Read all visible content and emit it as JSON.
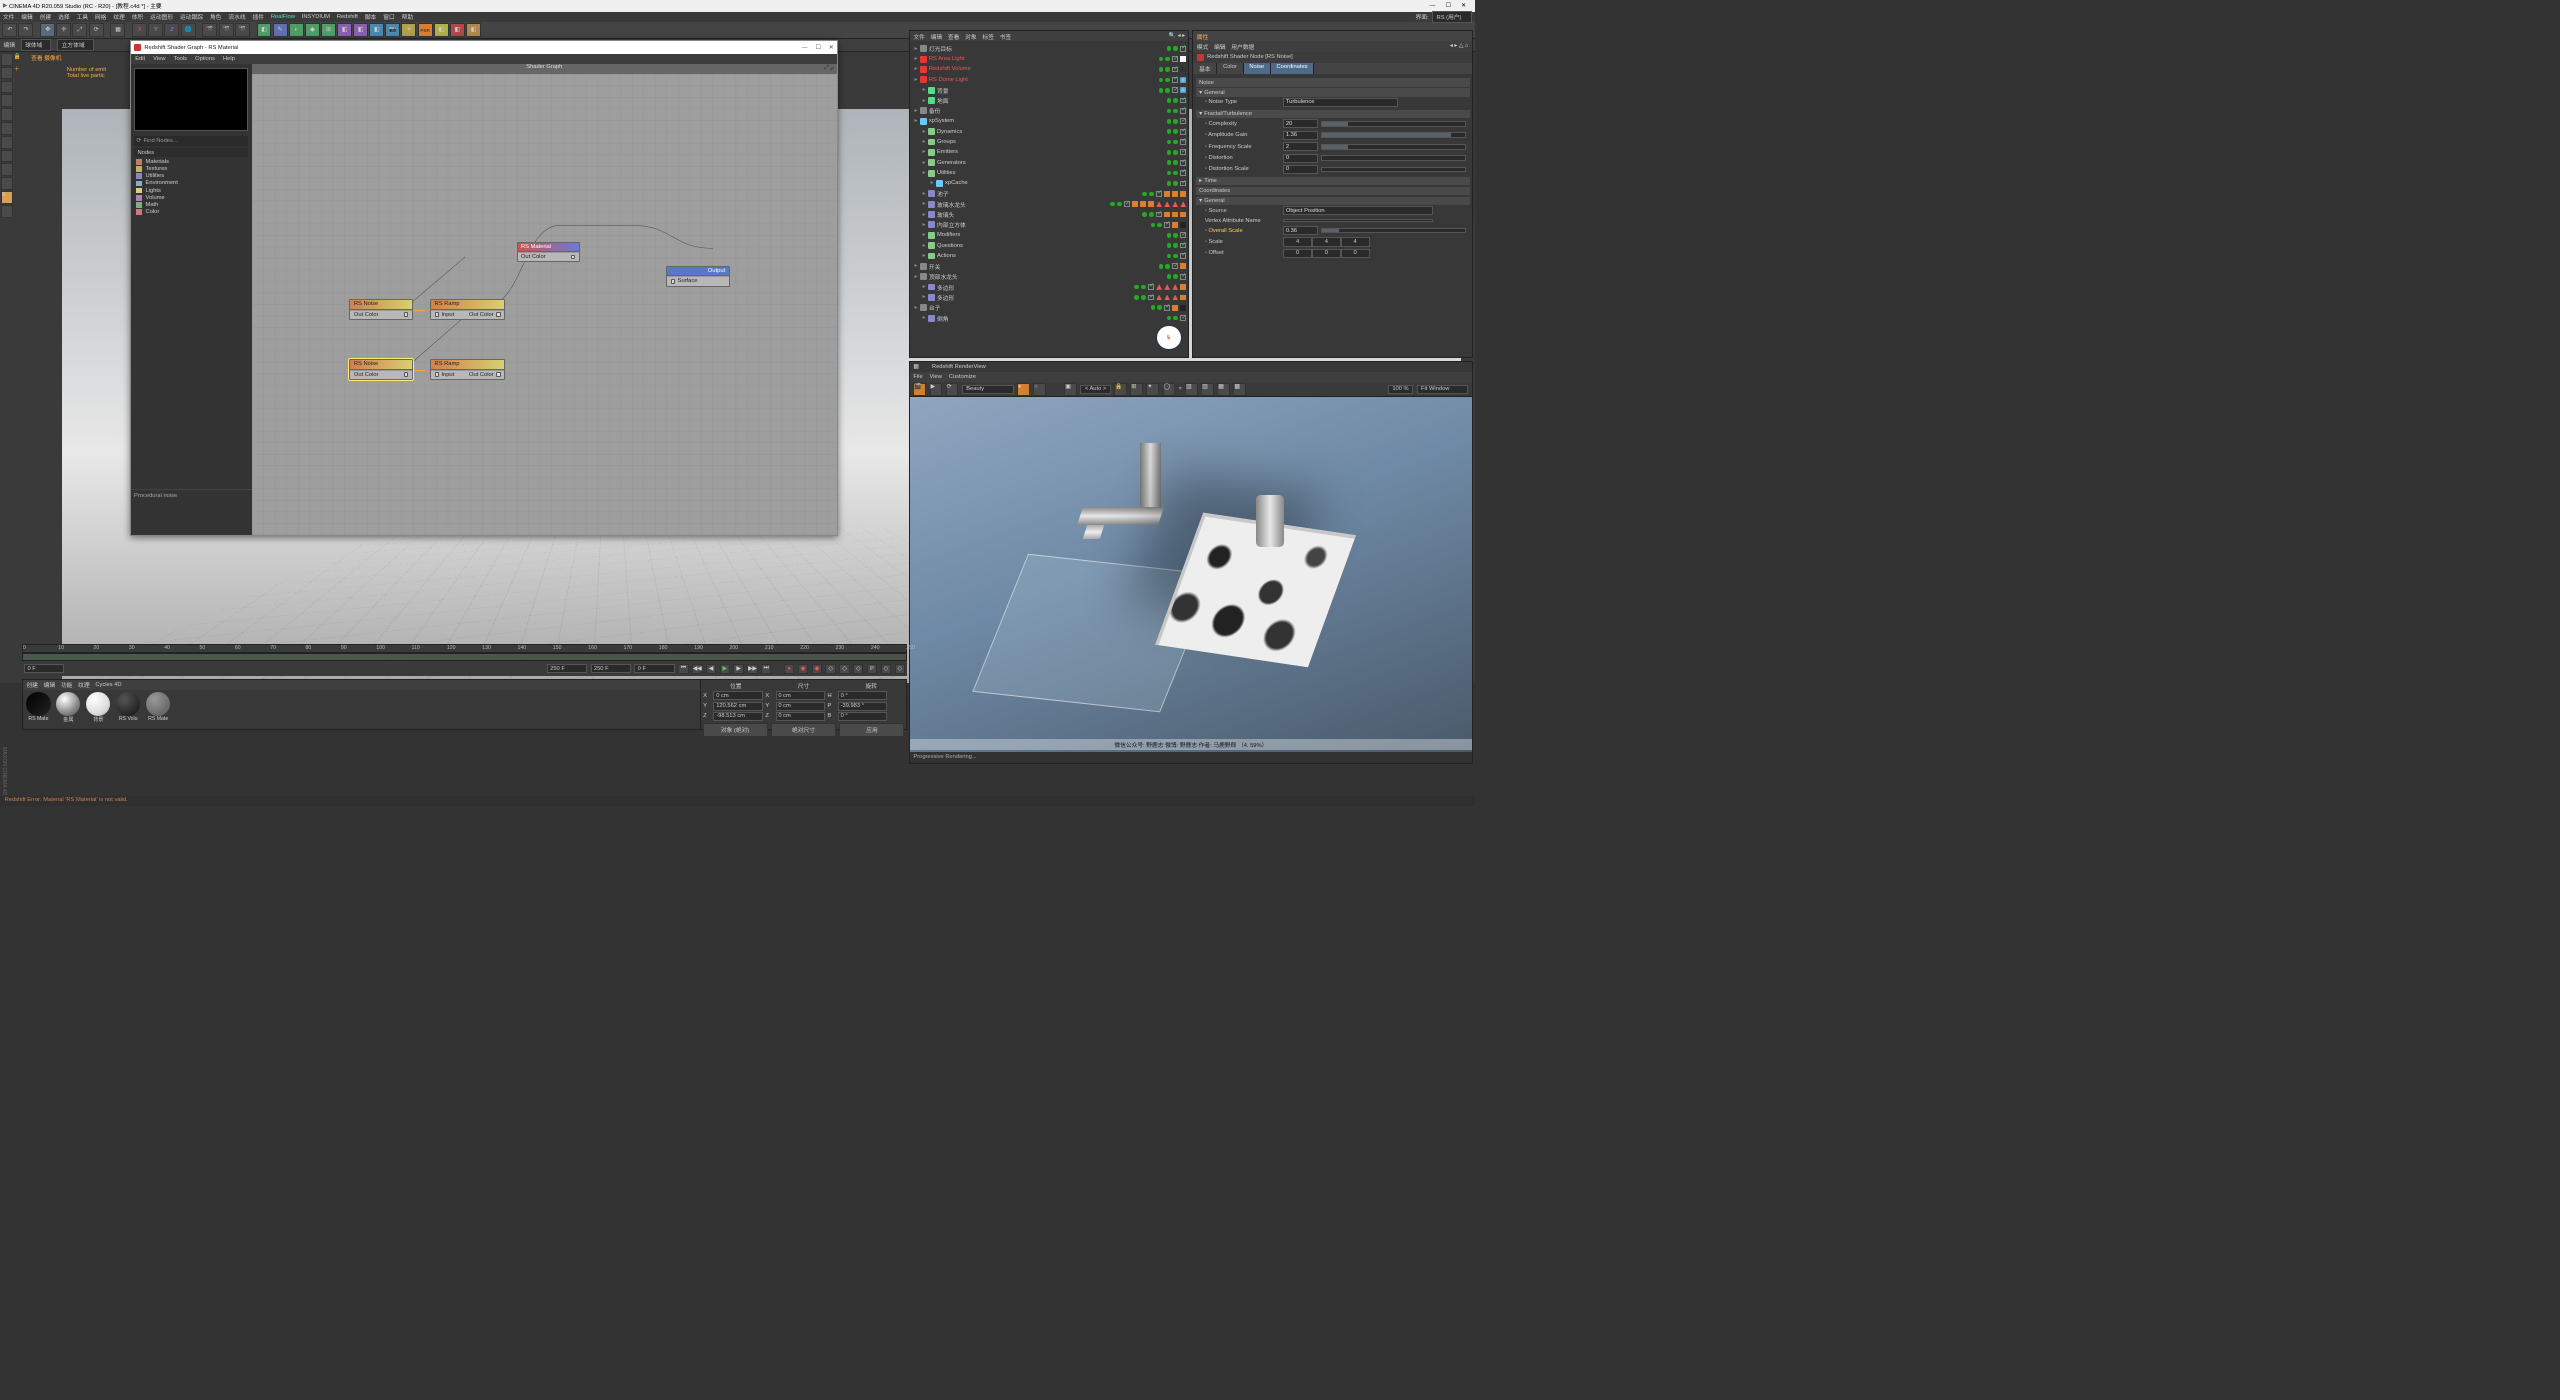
{
  "title": "CINEMA 4D R20.059 Studio (RC - R20) - [教程.c4d *] - 主要",
  "menus": [
    "文件",
    "编辑",
    "创建",
    "选择",
    "工具",
    "网格",
    "纹理",
    "体积",
    "运动图形",
    "运动跟踪",
    "角色",
    "流水线",
    "插件",
    "RealFlow",
    "INSYDIUM",
    "Redshift",
    "脚本",
    "窗口",
    "帮助"
  ],
  "layout_label": "界面:",
  "layout_value": "RS (用户)",
  "tool2": {
    "a": "编辑",
    "b": "球体域",
    "c": "立方体域"
  },
  "vpinfo": {
    "a": "查看  摄像机",
    "b": "Number of emit",
    "c": "Total live partic"
  },
  "sg": {
    "title": "Redshift Shader Graph - RS Material",
    "menus": [
      "Edit",
      "View",
      "Tools",
      "Options",
      "Help"
    ],
    "find": "Find Nodes...",
    "nodes_h": "Nodes",
    "cats": [
      {
        "name": "Materials",
        "c": "#c08060"
      },
      {
        "name": "Textures",
        "c": "#c0b060"
      },
      {
        "name": "Utilities",
        "c": "#8888c0"
      },
      {
        "name": "Environment",
        "c": "#88b0c8"
      },
      {
        "name": "Lights",
        "c": "#d8d080"
      },
      {
        "name": "Volume",
        "c": "#b080b0"
      },
      {
        "name": "Math",
        "c": "#80b080"
      },
      {
        "name": "Color",
        "c": "#d07878"
      }
    ],
    "canvas_title": "Shader Graph",
    "info": "Procedural noise",
    "n": {
      "noise1": {
        "t": "RS Noise",
        "p": "Out Color"
      },
      "noise2": {
        "t": "RS Noise",
        "p": "Out Color"
      },
      "ramp1": {
        "t": "RS Ramp",
        "pin": "Input",
        "pout": "Out Color"
      },
      "ramp2": {
        "t": "RS Ramp",
        "pin": "Input",
        "pout": "Out Color"
      },
      "mat": {
        "t": "RS Material",
        "p": "Out Color"
      },
      "out": {
        "t": "Output",
        "p": "Surface"
      }
    }
  },
  "objmgr": {
    "menus": [
      "文件",
      "编辑",
      "查看",
      "对象",
      "标签",
      "书签"
    ],
    "rows": [
      {
        "d": 0,
        "nm": "灯光目标",
        "ic": "#888",
        "rs": false
      },
      {
        "d": 0,
        "nm": "RS Area Light",
        "ic": "#e33",
        "rs": true,
        "tags": [
          "cir"
        ]
      },
      {
        "d": 0,
        "nm": "Redshift Volume",
        "ic": "#e33",
        "rs": true,
        "tags": [
          "sq"
        ]
      },
      {
        "d": 0,
        "nm": "RS Dome Light",
        "ic": "#e33",
        "rs": true,
        "tags": [
          "env"
        ]
      },
      {
        "d": 1,
        "nm": "背景",
        "ic": "#5d8",
        "tags": [
          "env2"
        ]
      },
      {
        "d": 1,
        "nm": "地面",
        "ic": "#5d8"
      },
      {
        "d": 0,
        "nm": "备份",
        "ic": "#888"
      },
      {
        "d": 0,
        "nm": "xpSystem",
        "ic": "#6cf"
      },
      {
        "d": 1,
        "nm": "Dynamics",
        "ic": "#8c8"
      },
      {
        "d": 1,
        "nm": "Groups",
        "ic": "#8c8"
      },
      {
        "d": 1,
        "nm": "Emitters",
        "ic": "#8c8"
      },
      {
        "d": 1,
        "nm": "Generators",
        "ic": "#8c8"
      },
      {
        "d": 1,
        "nm": "Utilities",
        "ic": "#8c8"
      },
      {
        "d": 2,
        "nm": "xpCache",
        "ic": "#6cf"
      },
      {
        "d": 1,
        "nm": "池子",
        "ic": "#88c",
        "tags": [
          "m",
          "m",
          "m"
        ]
      },
      {
        "d": 1,
        "nm": "玻璃水龙头",
        "ic": "#88c",
        "tags": [
          "m",
          "m",
          "m",
          "t",
          "t",
          "t",
          "t"
        ]
      },
      {
        "d": 1,
        "nm": "玻璃头",
        "ic": "#88c",
        "tags": [
          "m",
          "m",
          "m"
        ]
      },
      {
        "d": 1,
        "nm": "内部立方体",
        "ic": "#88c",
        "tags": [
          "m",
          "sq2"
        ]
      },
      {
        "d": 1,
        "nm": "Modifiers",
        "ic": "#8c8"
      },
      {
        "d": 1,
        "nm": "Questions",
        "ic": "#8c8"
      },
      {
        "d": 1,
        "nm": "Actions",
        "ic": "#8c8"
      },
      {
        "d": 0,
        "nm": "开关",
        "ic": "#888",
        "tags": [
          "m"
        ]
      },
      {
        "d": 0,
        "nm": "顶部水龙头",
        "ic": "#888"
      },
      {
        "d": 1,
        "nm": "多边形",
        "ic": "#88c",
        "tags": [
          "t",
          "t",
          "t",
          "m"
        ]
      },
      {
        "d": 1,
        "nm": "多边形",
        "ic": "#88c",
        "tags": [
          "t",
          "t",
          "t",
          "m"
        ]
      },
      {
        "d": 0,
        "nm": "台子",
        "ic": "#888",
        "tags": [
          "m",
          "sq2"
        ]
      },
      {
        "d": 1,
        "nm": "倒角",
        "ic": "#88c"
      }
    ]
  },
  "attr": {
    "menus": [
      "模式",
      "编辑",
      "用户数据"
    ],
    "title": "Redshift Shader Node [RS Noise]",
    "tabs": [
      "基本",
      "Color",
      "Noise",
      "Coordinates"
    ],
    "active": [
      2,
      3
    ],
    "noise_h": "Noise",
    "gen_h": "General",
    "noisetype_l": "Noise Type",
    "noisetype_v": "Turbulence",
    "ft_h": "Fractal/Turbulence",
    "fields": [
      {
        "l": "Complexity",
        "v": "20",
        "f": 0.18
      },
      {
        "l": "Amplitude Gain",
        "v": "1.36",
        "f": 0.9
      },
      {
        "l": "Frequency Scale",
        "v": "2",
        "f": 0.18
      },
      {
        "l": "Distortion",
        "v": "0",
        "f": 0
      },
      {
        "l": "Distortion Scale",
        "v": "0",
        "f": 0
      }
    ],
    "time_h": "Time",
    "coord_h": "Coordinates",
    "source_l": "Source",
    "source_v": "Object Position",
    "van_l": "Vertex Attribute Name",
    "overall_l": "Overall Scale",
    "overall_v": "0.36",
    "overall_f": 0.12,
    "scale_l": "Scale",
    "scale_v": [
      "4",
      "4",
      "4"
    ],
    "offset_l": "Offset",
    "offset_v": [
      "0",
      "0",
      "0"
    ],
    "p_h": "属性"
  },
  "rv": {
    "h": "Redshift RenderView",
    "menus": [
      "File",
      "View",
      "Customize"
    ],
    "aov": "Beauty",
    "auto": "< Auto >",
    "zoom": "100 %",
    "fit": "Fit Window",
    "cap": "微信公众号: 野鹿志    微博: 野鹿志    作者: 马鹿野郎  （4. 59%）",
    "status": "Progressive Rendering..."
  },
  "tl": {
    "ticks": [
      "0",
      "10",
      "20",
      "30",
      "40",
      "50",
      "60",
      "70",
      "80",
      "90",
      "100",
      "110",
      "120",
      "130",
      "140",
      "150",
      "160",
      "170",
      "180",
      "190",
      "200",
      "210",
      "220",
      "230",
      "240",
      "250"
    ],
    "f0": "0 F",
    "f1": "250 F",
    "f2": "250 F",
    "f3": "0 F"
  },
  "mat": {
    "tabs": [
      "创建",
      "编辑",
      "功能",
      "纹理",
      "Cycles 4D"
    ],
    "items": [
      {
        "nm": "RS Mate",
        "bg": "linear-gradient(135deg,#000,#222)"
      },
      {
        "nm": "金属",
        "bg": "radial-gradient(circle at 35% 30%,#fff,#888 60%,#444)"
      },
      {
        "nm": "背景",
        "bg": "radial-gradient(circle at 35% 30%,#fff,#ddd 60%,#aaa)"
      },
      {
        "nm": "RS Volu",
        "bg": "radial-gradient(circle at 35% 30%,#555,#111)"
      },
      {
        "nm": "RS Mate",
        "bg": "radial-gradient(circle at 35% 30%,#999,#555)"
      }
    ]
  },
  "coord": {
    "h": [
      "位置",
      "尺寸",
      "旋转"
    ],
    "rows": [
      {
        "a": "X",
        "p": "0 cm",
        "s": "0 cm",
        "r": "0 °",
        "ax": "X",
        "sx": "X",
        "rx": "H"
      },
      {
        "a": "Y",
        "p": "120.562 cm",
        "s": "0 cm",
        "r": "-39.983 °",
        "ax": "Y",
        "sx": "Y",
        "rx": "P"
      },
      {
        "a": "Z",
        "p": "-98.513 cm",
        "s": "0 cm",
        "r": "0 °",
        "ax": "Z",
        "sx": "Z",
        "rx": "B"
      }
    ],
    "dd1": "对象 (绝对)",
    "dd2": "绝对尺寸",
    "apply": "应用"
  },
  "status": "Redshift Error: Material 'RS Material' is not valid.",
  "winbtns": {
    "min": "—",
    "max": "☐",
    "close": "✕"
  }
}
